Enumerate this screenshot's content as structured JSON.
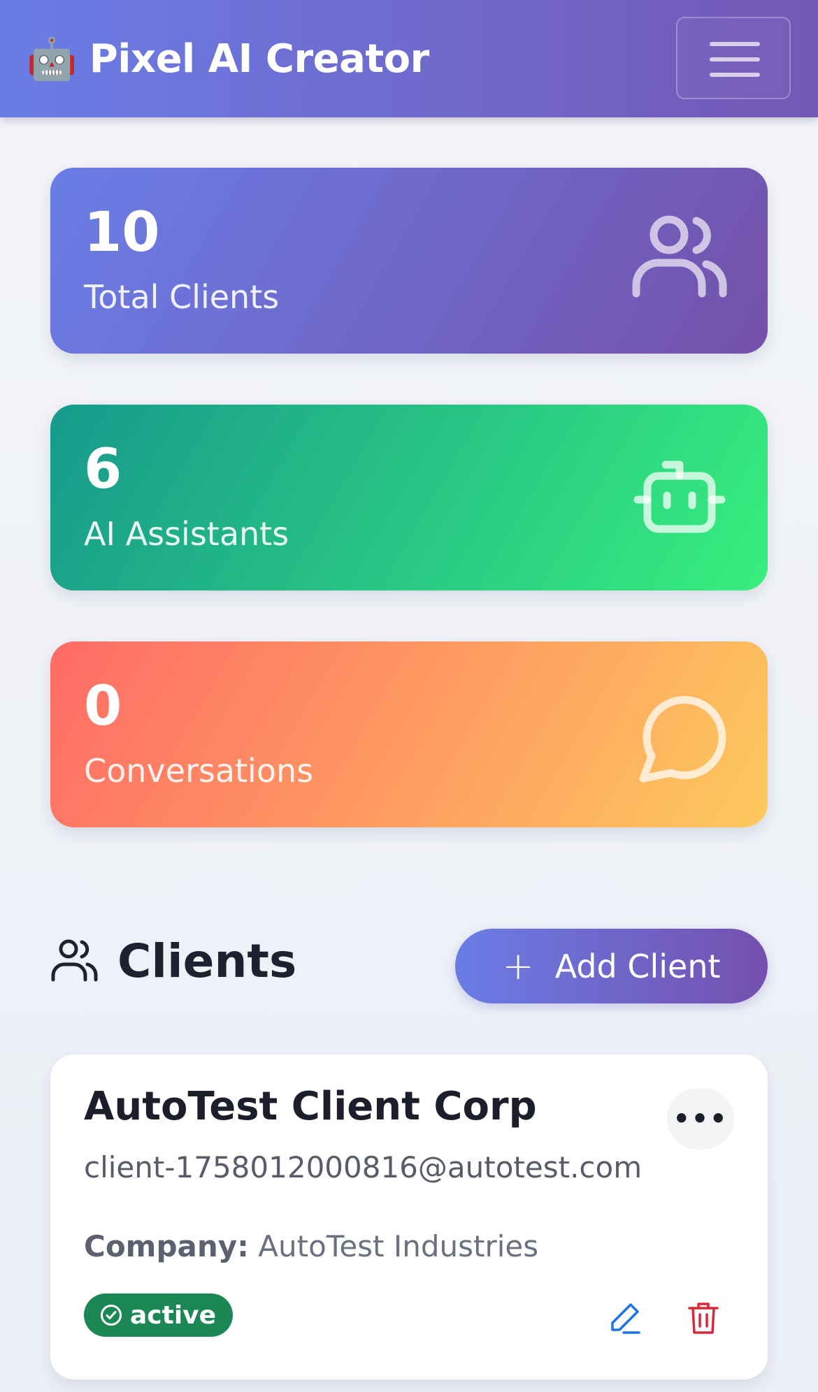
{
  "navbar": {
    "brand_icon": "🤖",
    "brand_title": "Pixel AI Creator",
    "menu_icon": "hamburger-icon"
  },
  "stats": [
    {
      "value": "10",
      "label": "Total Clients",
      "icon": "users-icon",
      "gradient": [
        "#6a7ee7",
        "#7451aa"
      ]
    },
    {
      "value": "6",
      "label": "AI Assistants",
      "icon": "robot-icon",
      "gradient": [
        "#17998c",
        "#38ef7d"
      ]
    },
    {
      "value": "0",
      "label": "Conversations",
      "icon": "chat-bubble-icon",
      "gradient": [
        "#ff6b66",
        "#fdc95d"
      ]
    }
  ],
  "clients_section": {
    "title": "Clients",
    "icon": "users-icon",
    "add_button_label": "Add Client"
  },
  "clients": [
    {
      "name": "AutoTest Client Corp",
      "email": "client-1758012000816@autotest.com",
      "company_label": "Company:",
      "company": "AutoTest Industries",
      "status": "active",
      "status_color": "#1b8754"
    }
  ],
  "colors": {
    "accent_start": "#6a7de6",
    "accent_end": "#7450ae",
    "edit_icon": "#1a73e8",
    "delete_icon": "#d9283a"
  }
}
